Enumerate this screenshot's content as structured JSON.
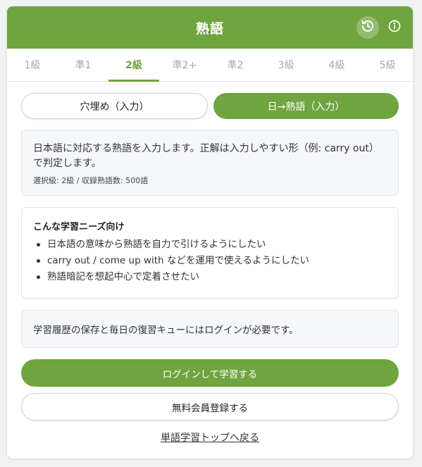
{
  "header": {
    "title": "熟語",
    "history_icon": "history-icon",
    "info_icon": "info-icon",
    "accent_color": "#6fa43f"
  },
  "level_tabs": [
    {
      "label": "1級",
      "active": false
    },
    {
      "label": "準1",
      "active": false
    },
    {
      "label": "2級",
      "active": true
    },
    {
      "label": "準2+",
      "active": false
    },
    {
      "label": "準2",
      "active": false
    },
    {
      "label": "3級",
      "active": false
    },
    {
      "label": "4級",
      "active": false
    },
    {
      "label": "5級",
      "active": false
    }
  ],
  "modes": {
    "fill_blank": "穴埋め（入力）",
    "ja_to_idiom": "日→熟語（入力）",
    "selected": "日→熟語（入力）"
  },
  "description": {
    "text": "日本語に対応する熟語を入力します。正解は入力しやすい形（例: carry out）で判定します。",
    "meta": "選択級: 2級 / 収録熟語数: 500語"
  },
  "needs": {
    "title": "こんな学習ニーズ向け",
    "items": [
      "日本語の意味から熟語を自力で引けるようにしたい",
      "carry out / come up with などを運用で使えるようにしたい",
      "熟語暗記を想起中心で定着させたい"
    ]
  },
  "login_note": "学習履歴の保存と毎日の復習キューにはログインが必要です。",
  "actions": {
    "login": "ログインして学習する",
    "register": "無料会員登録する",
    "back": "単語学習トップへ戻る"
  }
}
